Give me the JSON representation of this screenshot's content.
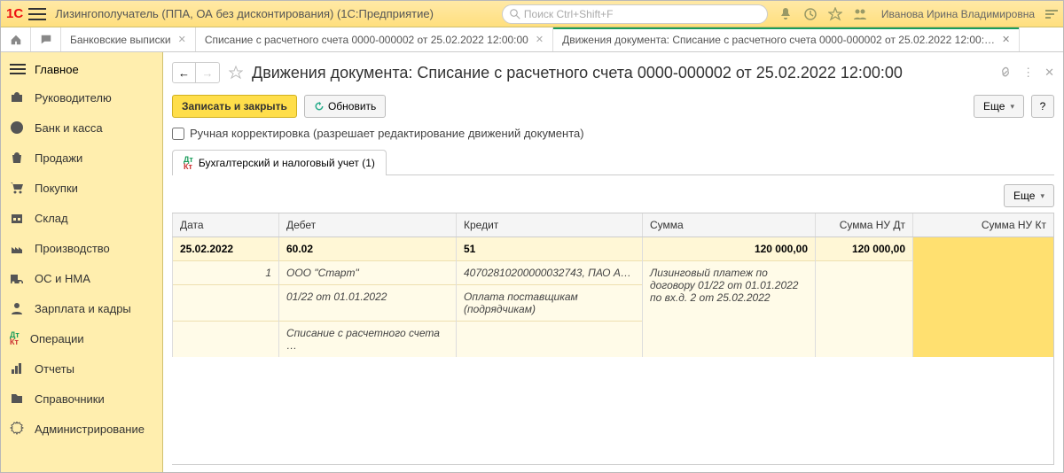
{
  "header": {
    "title": "Лизингополучатель (ППА, ОА без дисконтирования)  (1С:Предприятие)",
    "search_placeholder": "Поиск Ctrl+Shift+F",
    "user": "Иванова Ирина Владимировна"
  },
  "tabs": [
    {
      "label": "Банковские выписки",
      "active": false
    },
    {
      "label": "Списание с расчетного счета 0000-000002 от 25.02.2022 12:00:00",
      "active": false
    },
    {
      "label": "Движения документа: Списание с расчетного счета 0000-000002 от 25.02.2022 12:00:…",
      "active": true
    }
  ],
  "sidebar": {
    "top": "Главное",
    "items": [
      "Руководителю",
      "Банк и касса",
      "Продажи",
      "Покупки",
      "Склад",
      "Производство",
      "ОС и НМА",
      "Зарплата и кадры",
      "Операции",
      "Отчеты",
      "Справочники",
      "Администрирование"
    ]
  },
  "doc": {
    "title": "Движения документа: Списание с расчетного счета 0000-000002 от 25.02.2022 12:00:00"
  },
  "toolbar": {
    "save_close": "Записать и закрыть",
    "refresh": "Обновить",
    "more": "Еще",
    "help": "?",
    "manual_checkbox": "Ручная корректировка (разрешает редактирование движений документа)"
  },
  "sub_tab": "Бухгалтерский и налоговый учет (1)",
  "table": {
    "more": "Еще",
    "headers": [
      "Дата",
      "Дебет",
      "Кредит",
      "Сумма",
      "Сумма НУ Дт",
      "Сумма НУ Кт"
    ],
    "main_row": {
      "date": "25.02.2022",
      "debit": "60.02",
      "credit": "51",
      "sum": "120 000,00",
      "sum_nu_dt": "120 000,00",
      "sum_nu_kt": ""
    },
    "sub_rows": [
      {
        "num": "1",
        "debit": "ООО \"Старт\"",
        "credit": "40702810200000032743, ПАО А…",
        "sum": "Лизинговый платеж по договору 01/22 от 01.01.2022 по вх.д. 2 от 25.02.2022"
      },
      {
        "num": "",
        "debit": "01/22 от 01.01.2022",
        "credit": "Оплата поставщикам (подрядчикам)",
        "sum": ""
      },
      {
        "num": "",
        "debit": "Списание с расчетного счета …",
        "credit": "",
        "sum": ""
      }
    ]
  }
}
